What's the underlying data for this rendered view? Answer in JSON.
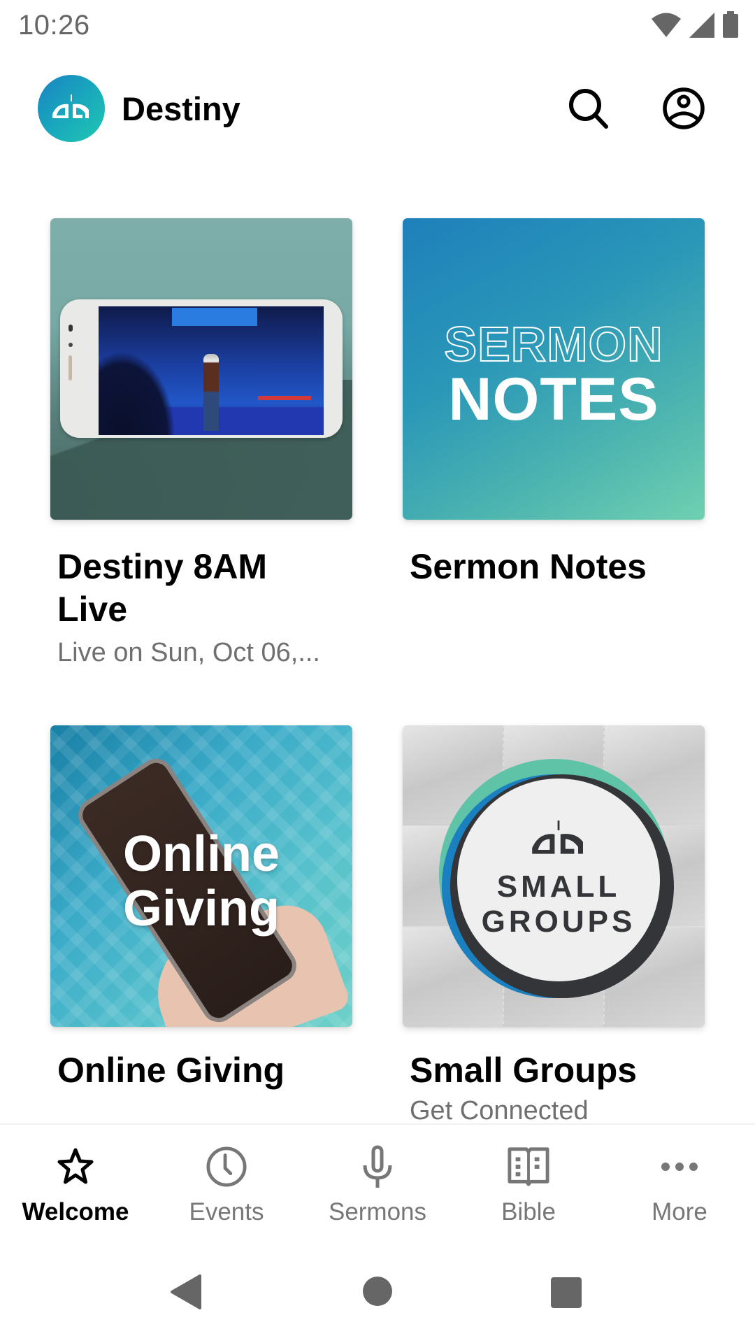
{
  "status_bar": {
    "time": "10:26",
    "icons": [
      "wifi-icon",
      "cell-signal-icon",
      "battery-icon"
    ]
  },
  "header": {
    "app_name": "Destiny",
    "logo_icon": "church-logo-icon",
    "actions": [
      {
        "name": "search",
        "icon": "search-icon"
      },
      {
        "name": "profile",
        "icon": "account-circle-icon"
      }
    ]
  },
  "cards": [
    {
      "title": "Destiny 8AM Live",
      "subtitle": "Live on Sun, Oct 06,...",
      "image_alt": "Phone showing live church service on stage"
    },
    {
      "title": "Sermon Notes",
      "subtitle": "",
      "image_text_line1": "SERMON",
      "image_text_line2": "NOTES"
    },
    {
      "title": "Online Giving",
      "subtitle": "",
      "image_text_line1": "Online",
      "image_text_line2": "Giving"
    },
    {
      "title": "Small Groups",
      "subtitle": "Get Connected",
      "image_text_line1": "SMALL",
      "image_text_line2": "GROUPS"
    }
  ],
  "tabs": [
    {
      "label": "Welcome",
      "icon": "star-icon",
      "active": true
    },
    {
      "label": "Events",
      "icon": "clock-icon",
      "active": false
    },
    {
      "label": "Sermons",
      "icon": "microphone-icon",
      "active": false
    },
    {
      "label": "Bible",
      "icon": "book-icon",
      "active": false
    },
    {
      "label": "More",
      "icon": "more-horizontal-icon",
      "active": false
    }
  ],
  "colors": {
    "active_tab": "#000000",
    "inactive_tab": "#777777",
    "subtitle": "#6f6f6f",
    "logo_gradient_start": "#1a83c2",
    "logo_gradient_end": "#1fc8b2",
    "system_icons": "#666666"
  },
  "system_nav": [
    "back",
    "home",
    "recents"
  ]
}
